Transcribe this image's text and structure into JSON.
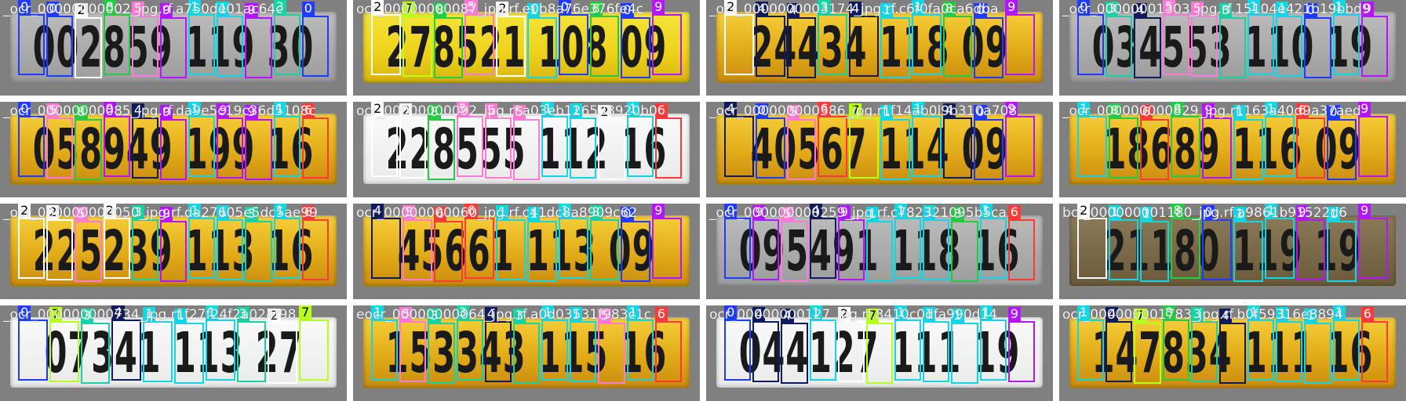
{
  "grid": {
    "rows": 4,
    "cols": 4
  },
  "colors": {
    "0": "#1f3bff",
    "1": "#12d6e6",
    "2": "#ffffff",
    "3": "#18d2a6",
    "4": "#101a5c",
    "5": "#ff7ad6",
    "6": "#ff3838",
    "7": "#b8ff1a",
    "8": "#22cc44",
    "9": "#b414ff"
  },
  "tiles": [
    {
      "plate": "002859 119 30",
      "style": "grey",
      "filename": "_ocr_00000000002_jpg.rf.a750de01ac64c",
      "labels": [
        "0",
        "0",
        "2",
        "8",
        "5",
        "9",
        "1",
        "1",
        "9",
        "3",
        "0"
      ]
    },
    {
      "plate": "278521 108 09",
      "style": "yellow2",
      "filename": "ocr_00000000087_jpg.rf.e0b8a76e376fe4c",
      "labels": [
        "2",
        "7",
        "8",
        "5",
        "2",
        "1",
        "0",
        "8",
        "0",
        "9"
      ]
    },
    {
      "plate": "24434 118 09",
      "style": "yellow",
      "filename": "_ocr_0000000003174_jpg.rf.c6f0fa0ca6dba",
      "labels": [
        "2",
        "4",
        "4",
        "3",
        "4",
        "1",
        "1",
        "8",
        "0",
        "9"
      ]
    },
    {
      "plate": "034553 110 19",
      "style": "grey",
      "filename": "_ocr_00000001303_jpg.rf.15104e421b19bbd9",
      "labels": [
        "0",
        "3",
        "4",
        "5",
        "5",
        "3",
        "1",
        "1",
        "0",
        "1",
        "9"
      ]
    },
    {
      "plate": "058949 199 16",
      "style": "yellow",
      "filename": "_ocr_00000000085_jpg.rf.da9e5c19c36d5108c",
      "labels": [
        "0",
        "5",
        "8",
        "9",
        "4",
        "9",
        "1",
        "9",
        "9",
        "1",
        "6"
      ]
    },
    {
      "plate": "228555 112 16",
      "style": "white",
      "filename": "ocr_00000000092_jpg.rf.a03eb126538920b0",
      "labels": [
        "2",
        "2",
        "8",
        "5",
        "5",
        "5",
        "1",
        "1",
        "2",
        "1",
        "6"
      ]
    },
    {
      "plate": "40567 114 09",
      "style": "yellow",
      "filename": "_ocr_000000000386_jpg.rf.f14ab0l9b310a708",
      "labels": [
        "4",
        "0",
        "5",
        "6",
        "7",
        "1",
        "1",
        "4",
        "0",
        "9"
      ]
    },
    {
      "plate": "18689 116 09",
      "style": "yellow",
      "filename": "_ocr_000000000829_jpg.rf.163a40d9a37aed",
      "labels": [
        "1",
        "8",
        "6",
        "8",
        "9",
        "1",
        "1",
        "6",
        "0",
        "9"
      ]
    },
    {
      "plate": "225239 113 16",
      "style": "yellow",
      "filename": "_ocr_000000000050_jpg.rf.da27605e5dc5ae99",
      "labels": [
        "2",
        "2",
        "5",
        "2",
        "3",
        "9",
        "1",
        "1",
        "3",
        "1",
        "6"
      ]
    },
    {
      "plate": "45661 113 09",
      "style": "yellow",
      "filename": "ocr_00000000060_jpg.rf.c41dc8a8909c62",
      "labels": [
        "4",
        "5",
        "6",
        "6",
        "1",
        "1",
        "1",
        "3",
        "0",
        "9"
      ]
    },
    {
      "plate": "095491 118 16",
      "style": "grey",
      "filename": "_ocr_000000000259_jpg.rf.c782321095b5ca",
      "labels": [
        "0",
        "9",
        "5",
        "4",
        "9",
        "1",
        "1",
        "1",
        "8",
        "1",
        "6"
      ]
    },
    {
      "plate": "21180 119 19",
      "style": "dark",
      "filename": "bcr_000000001180_jpg.rf.a9861b91522d6",
      "labels": [
        "2",
        "1",
        "1",
        "8",
        "0",
        "1",
        "1",
        "9",
        "1",
        "9"
      ]
    },
    {
      "plate": "07341 113 27",
      "style": "white",
      "filename": "_ocr_000000000734_jpg.rf.f27f24f2a024f98",
      "labels": [
        "0",
        "7",
        "3",
        "4",
        "1",
        "1",
        "1",
        "3",
        "2",
        "7"
      ]
    },
    {
      "plate": "153343 115 16",
      "style": "yellow",
      "filename": "eocr_00000000064_jpg.rf.a0d03531f983c1c",
      "labels": [
        "1",
        "5",
        "3",
        "3",
        "4",
        "3",
        "1",
        "1",
        "5",
        "1",
        "6"
      ]
    },
    {
      "plate": "044127 111 19",
      "style": "white",
      "filename": "ocr_00000000127_jpg.rf.8410c0dfa990d14",
      "labels": [
        "0",
        "4",
        "4",
        "1",
        "2",
        "7",
        "1",
        "1",
        "1",
        "1",
        "9"
      ]
    },
    {
      "plate": "147834 111 16",
      "style": "yellow",
      "filename": "ocr_000000001783_jpg.rf.b0f59316e8894",
      "labels": [
        "1",
        "4",
        "7",
        "8",
        "3",
        "4",
        "1",
        "1",
        "1",
        "1",
        "6"
      ]
    }
  ]
}
